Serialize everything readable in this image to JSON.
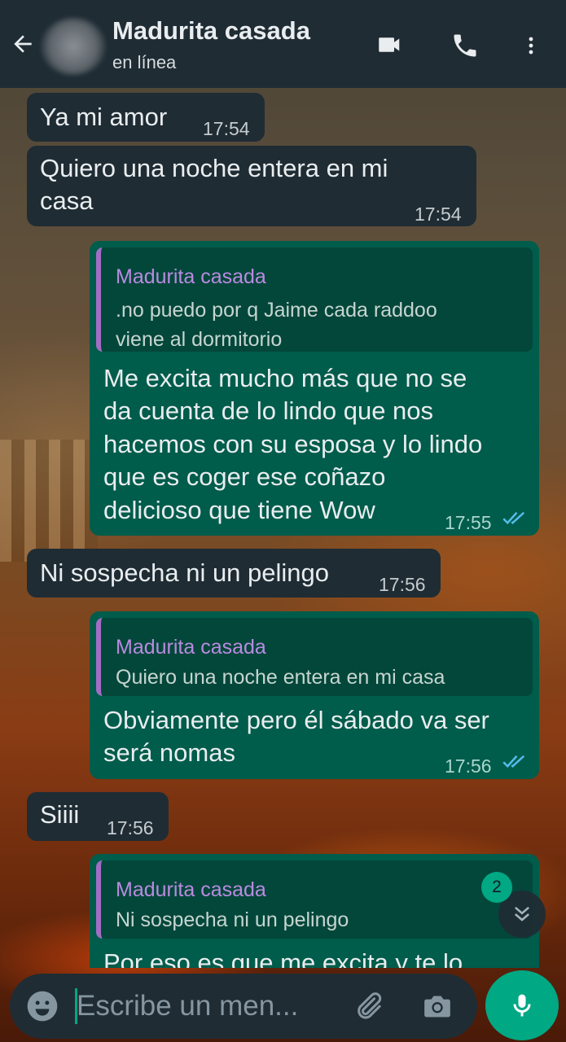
{
  "header": {
    "contact_name": "Madurita casada",
    "status": "en línea"
  },
  "messages": [
    {
      "dir": "in",
      "text": "Ya mi amor",
      "time": "17:54"
    },
    {
      "dir": "in",
      "text_lines": [
        "Quiero una noche entera en mi",
        "casa"
      ],
      "time": "17:54"
    },
    {
      "dir": "out",
      "quote_name": "Madurita casada",
      "quote_lines": [
        ".no puedo por q Jaime cada raddoo",
        "viene al dormitorio"
      ],
      "text_lines": [
        "Me excita mucho más que no se",
        "da cuenta de lo lindo que nos",
        "hacemos con su esposa y lo lindo",
        "que es coger ese coñazo",
        "delicioso que tiene Wow"
      ],
      "time": "17:55"
    },
    {
      "dir": "in",
      "text": "Ni sospecha ni un pelingo",
      "time": "17:56"
    },
    {
      "dir": "out",
      "quote_name": "Madurita casada",
      "quote_lines": [
        "Quiero una noche entera en mi casa"
      ],
      "text_lines": [
        "Obviamente pero él sábado va ser",
        "será nomas"
      ],
      "time": "17:56"
    },
    {
      "dir": "in",
      "text": "Siiii",
      "time": "17:56"
    },
    {
      "dir": "out",
      "quote_name": "Madurita casada",
      "quote_lines": [
        "Ni sospecha ni un pelingo"
      ],
      "text_lines": [
        "Por eso es que me excita y te lo"
      ]
    }
  ],
  "unread_badge": "2",
  "composer": {
    "placeholder": "Escribe un men..."
  },
  "icons": {
    "back": "arrow-left-icon",
    "video": "video-call-icon",
    "call": "phone-icon",
    "menu": "more-vert-icon",
    "emoji": "emoji-icon",
    "attach": "paperclip-icon",
    "camera": "camera-icon",
    "mic": "mic-icon",
    "scroll": "double-chevron-down-icon"
  },
  "colors": {
    "header_bg": "#1f2c34",
    "incoming_bubble": "#1f2c34",
    "outgoing_bubble": "#005c4b",
    "accent": "#00a884",
    "quote_name": "#b98be0",
    "read_ticks": "#53bdeb"
  }
}
